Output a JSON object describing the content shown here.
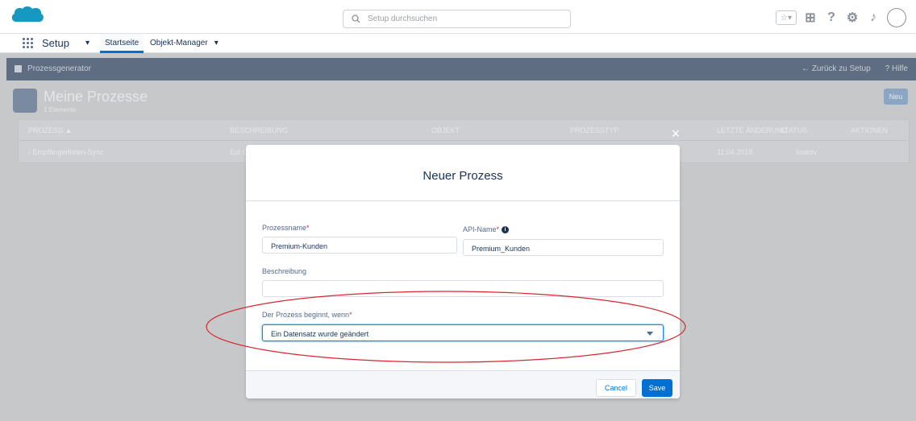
{
  "header": {
    "search_placeholder": "Setup durchsuchen",
    "icons": [
      "favorites-icon",
      "add-icon",
      "help-icon",
      "setup-gear-icon",
      "notifications-bell-icon",
      "avatar"
    ]
  },
  "nav": {
    "app_name": "Setup",
    "tabs": [
      {
        "label": "Startseite",
        "active": true
      },
      {
        "label": "Objekt-Manager",
        "active": false
      }
    ]
  },
  "page_bar": {
    "title": "Prozessgenerator",
    "back_link": "← Zurück zu Setup",
    "help_link": "? Hilfe"
  },
  "page": {
    "title": "Meine Prozesse",
    "subtitle": "1 Elemente",
    "new_button": "Neu",
    "table": {
      "headers": [
        "PROZESS ▲",
        "BESCHREIBUNG",
        "OBJEKT",
        "PROZESSTYP",
        "LETZTE ÄNDERUNG",
        "STATUS",
        "AKTIONEN"
      ],
      "rows": [
        [
          "› Empfängerlisten-Sync",
          "Epl C",
          "",
          "",
          "11.04.2018",
          "Inaktiv",
          ""
        ]
      ]
    }
  },
  "modal": {
    "title": "Neuer Prozess",
    "close_label": "×",
    "process_name_label": "Prozessname",
    "process_name_value": "Premium-Kunden",
    "api_name_label": "API-Name",
    "api_name_value": "Premium_Kunden",
    "description_label": "Beschreibung",
    "description_value": "",
    "starts_when_label": "Der Prozess beginnt, wenn",
    "starts_when_value": "Ein Datensatz wurde geändert",
    "required_marker": "*",
    "info_marker": "i",
    "cancel_label": "Cancel",
    "save_label": "Save"
  },
  "colors": {
    "brand_blue": "#0070d2",
    "highlight_ellipse": "#d9262f",
    "overlay": "#c6c8ca"
  }
}
